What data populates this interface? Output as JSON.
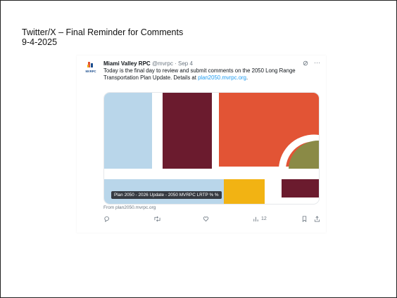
{
  "slide": {
    "title_line1": "Twitter/X – Final Reminder for Comments",
    "title_line2": "9-4-2025"
  },
  "tweet": {
    "author": "Miami Valley RPC",
    "handle": "@mvrpc",
    "date": "Sep 4",
    "logo_text": "MVRPC",
    "body_prefix": "Today is the final day to review and submit comments on the 2050 Long Range Transportation Plan Update. Details at ",
    "body_link": "plan2050.mvrpc.org",
    "body_suffix": ".",
    "card_caption": "Plan 2050 - 2026 Update - 2050 MVRPC LRTP % %",
    "card_source": "From plan2050.mvrpc.org",
    "views_count": "12"
  },
  "icons": {
    "grok": "grok-icon",
    "more": "more-icon",
    "reply": "reply-icon",
    "retweet": "retweet-icon",
    "like": "like-icon",
    "views": "views-icon",
    "bookmark": "bookmark-icon",
    "share": "share-icon"
  },
  "colors": {
    "light_blue": "#b9d6ea",
    "maroon": "#6b1b2e",
    "orange_red": "#e25435",
    "olive": "#8a8a46",
    "yellow": "#f2b313",
    "link_blue": "#1d9bf0"
  }
}
